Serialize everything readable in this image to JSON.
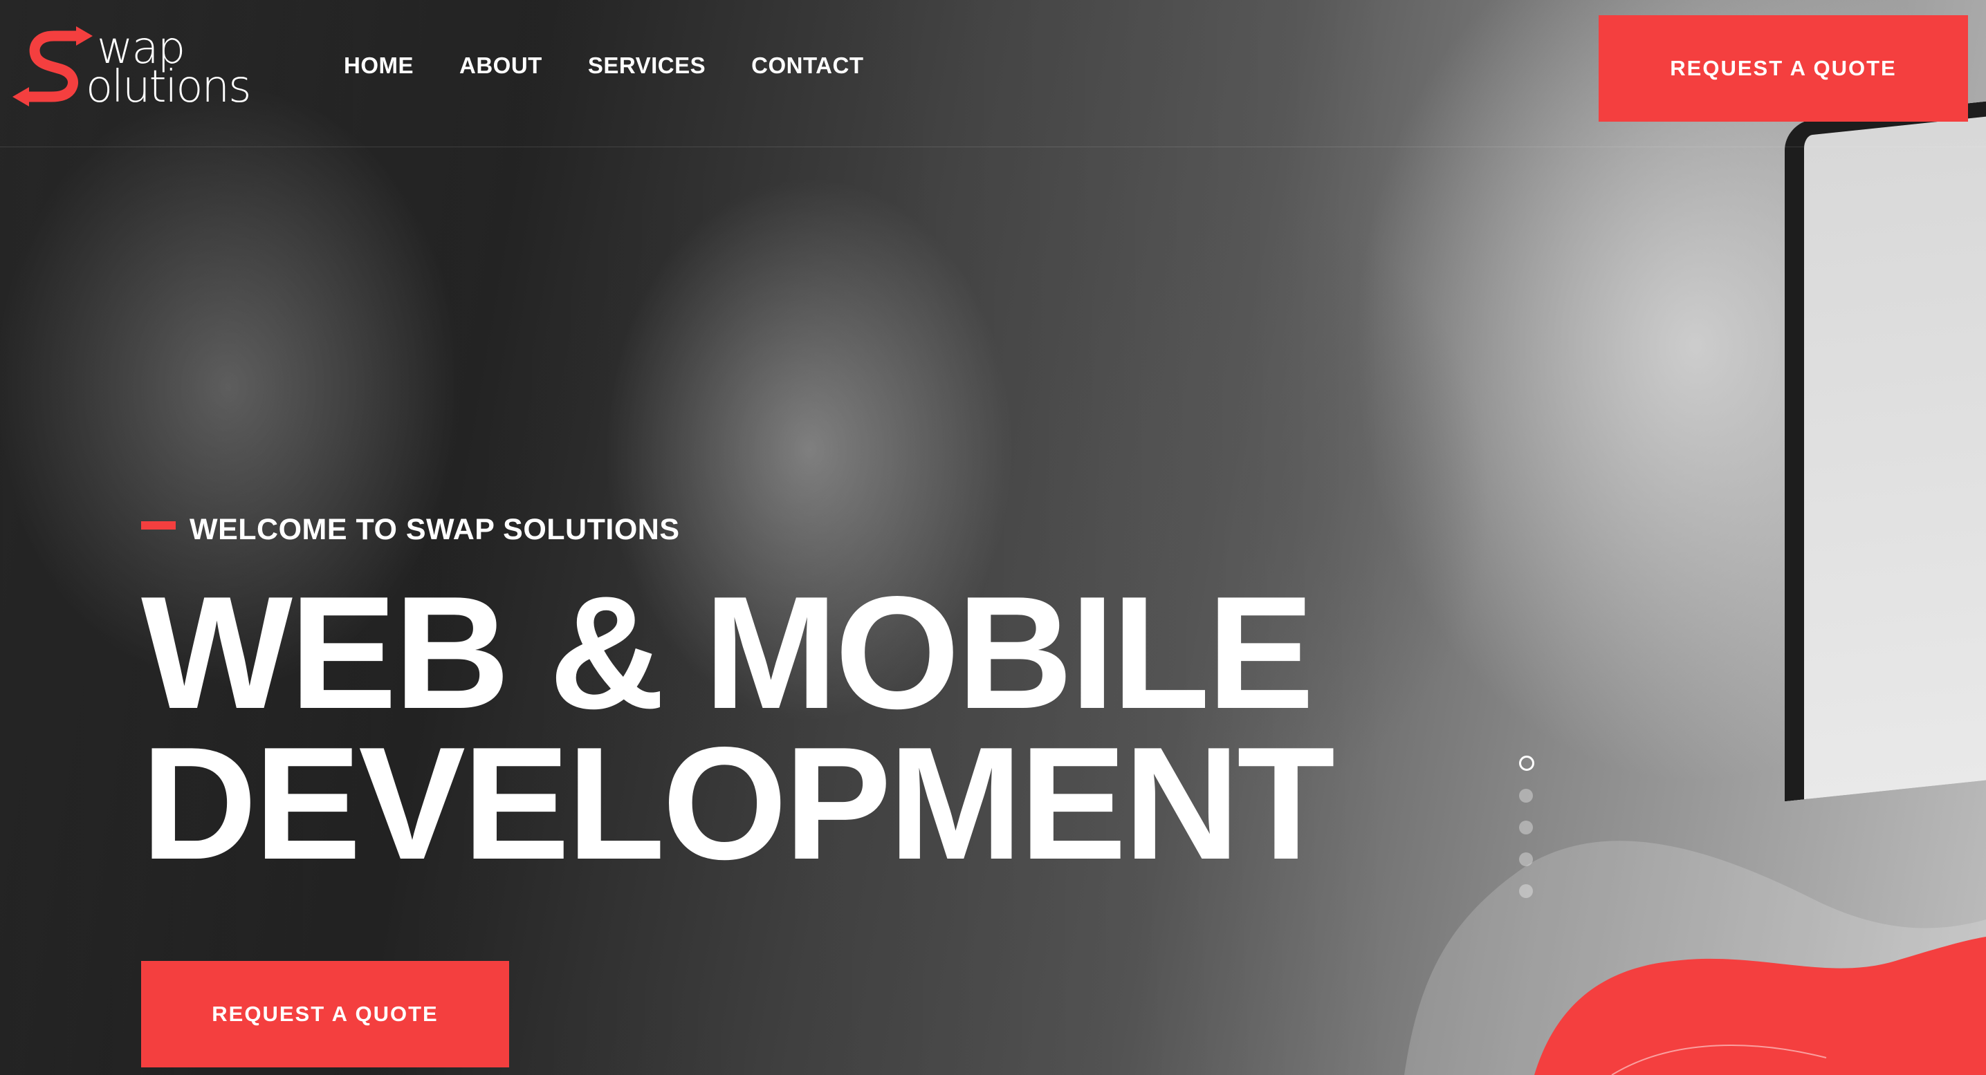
{
  "brand": {
    "logo_line1": "wap",
    "logo_line2": "olutions",
    "accent_color": "#f43f3f"
  },
  "nav": {
    "items": [
      {
        "label": "HOME"
      },
      {
        "label": "ABOUT"
      },
      {
        "label": "SERVICES"
      },
      {
        "label": "CONTACT"
      }
    ],
    "cta_label": "REQUEST A QUOTE"
  },
  "hero": {
    "eyebrow": "WELCOME TO SWAP SOLUTIONS",
    "title_line1": "WEB & MOBILE",
    "title_line2": "DEVELOPMENT",
    "cta_label": "REQUEST A QUOTE"
  },
  "slider": {
    "slide_count": 5,
    "active_index": 0
  }
}
